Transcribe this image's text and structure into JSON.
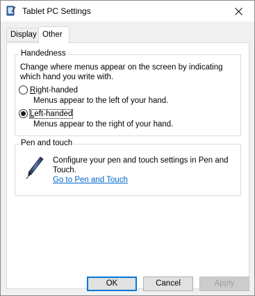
{
  "window": {
    "title": "Tablet PC Settings",
    "close_symbol": "✕"
  },
  "tabs": [
    {
      "label": "Display",
      "selected": false
    },
    {
      "label": "Other",
      "selected": true
    }
  ],
  "handedness": {
    "group_title": "Handedness",
    "description": "Change where menus appear on the screen by indicating which hand you write with.",
    "options": [
      {
        "label": "Right-handed",
        "mnemonic": "R",
        "rest": "ight-handed",
        "sub": "Menus appear to the left of your hand.",
        "checked": false
      },
      {
        "label": "Left-handed",
        "mnemonic": "L",
        "rest": "eft-handed",
        "sub": "Menus appear to the right of your hand.",
        "checked": true
      }
    ]
  },
  "pen_touch": {
    "group_title": "Pen and touch",
    "description": "Configure your pen and touch settings in Pen and Touch.",
    "link": "Go to Pen and Touch",
    "icon": "pen-icon"
  },
  "buttons": {
    "ok": "OK",
    "cancel": "Cancel",
    "apply": "Apply",
    "apply_enabled": false
  }
}
